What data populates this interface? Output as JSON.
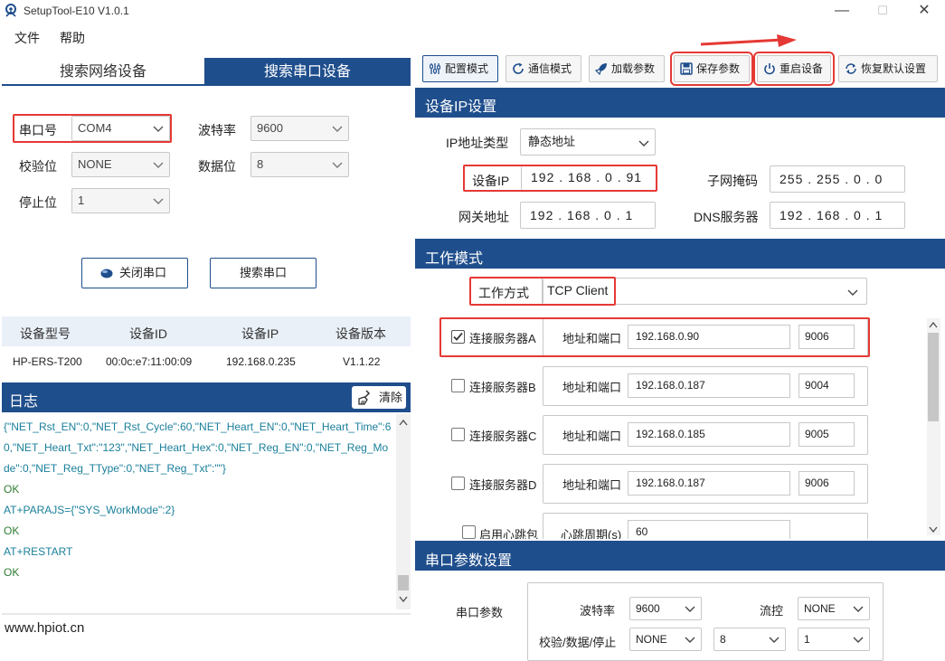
{
  "window": {
    "title": "SetupTool-E10 V1.0.1",
    "minimize": "—",
    "maximize": "☐",
    "close": "✕"
  },
  "menu": {
    "file": "文件",
    "help": "帮助"
  },
  "left_tabs": {
    "network": "搜索网络设备",
    "serial": "搜索串口设备"
  },
  "serial_form": {
    "port_label": "串口号",
    "port_value": "COM4",
    "baud_label": "波特率",
    "baud_value": "9600",
    "parity_label": "校验位",
    "parity_value": "NONE",
    "databits_label": "数据位",
    "databits_value": "8",
    "stopbits_label": "停止位",
    "stopbits_value": "1"
  },
  "left_buttons": {
    "close_port": "关闭串口",
    "search_port": "搜索串口"
  },
  "device_table": {
    "headers": [
      "设备型号",
      "设备ID",
      "设备IP",
      "设备版本"
    ],
    "rows": [
      [
        "HP-ERS-T200",
        "00:0c:e7:11:00:09",
        "192.168.0.235",
        "V1.1.22"
      ]
    ]
  },
  "log": {
    "title": "日志",
    "clear_label": "清除",
    "lines": [
      "{\"NET_Rst_EN\":0,\"NET_Rst_Cycle\":60,\"NET_Heart_EN\":0,\"NET_Heart_Time\":6",
      "0,\"NET_Heart_Txt\":\"123\",\"NET_Heart_Hex\":0,\"NET_Reg_EN\":0,\"NET_Reg_Mo",
      "de\":0,\"NET_Reg_TType\":0,\"NET_Reg_Txt\":\"\"}",
      "OK",
      "AT+PARAJS={\"SYS_WorkMode\":2}",
      "OK",
      "AT+RESTART",
      "OK"
    ]
  },
  "footer_url": "www.hpiot.cn",
  "toolbar": {
    "config_mode": "配置模式",
    "comm_mode": "通信模式",
    "load_params": "加载参数",
    "save_params": "保存参数",
    "restart_device": "重启设备",
    "restore_default": "恢复默认设置"
  },
  "ip_section": {
    "title": "设备IP设置",
    "ip_type_label": "IP地址类型",
    "ip_type_value": "静态地址",
    "device_ip_label": "设备IP",
    "device_ip_value": "192 . 168 .  0  . 91",
    "subnet_label": "子网掩码",
    "subnet_value": "255 . 255 .  0  .  0",
    "gateway_label": "网关地址",
    "gateway_value": "192 . 168 .  0  .  1",
    "dns_label": "DNS服务器",
    "dns_value": "192 . 168 .  0  .  1"
  },
  "work_section": {
    "title": "工作模式",
    "mode_label": "工作方式",
    "mode_value": "TCP Client",
    "addr_label": "地址和端口",
    "servers": [
      {
        "label": "连接服务器A",
        "checked": true,
        "address": "192.168.0.90",
        "port": "9006"
      },
      {
        "label": "连接服务器B",
        "checked": false,
        "address": "192.168.0.187",
        "port": "9004"
      },
      {
        "label": "连接服务器C",
        "checked": false,
        "address": "192.168.0.185",
        "port": "9005"
      },
      {
        "label": "连接服务器D",
        "checked": false,
        "address": "192.168.0.187",
        "port": "9006"
      }
    ],
    "heartbeat_label": "启用心跳包",
    "heartbeat_period_label": "心跳周期(s)",
    "heartbeat_period_value": "60"
  },
  "serial_section": {
    "title": "串口参数设置",
    "params_label": "串口参数",
    "baud_label": "波特率",
    "baud_value": "9600",
    "flow_label": "流控",
    "flow_value": "NONE",
    "pds_label": "校验/数据/停止",
    "parity_value": "NONE",
    "databits_value": "8",
    "stopbits_value": "1"
  },
  "colors": {
    "primary": "#1f4e8c",
    "highlight": "#e53935",
    "log_text": "#1a7f9b",
    "ok_text": "#2e7d32"
  }
}
